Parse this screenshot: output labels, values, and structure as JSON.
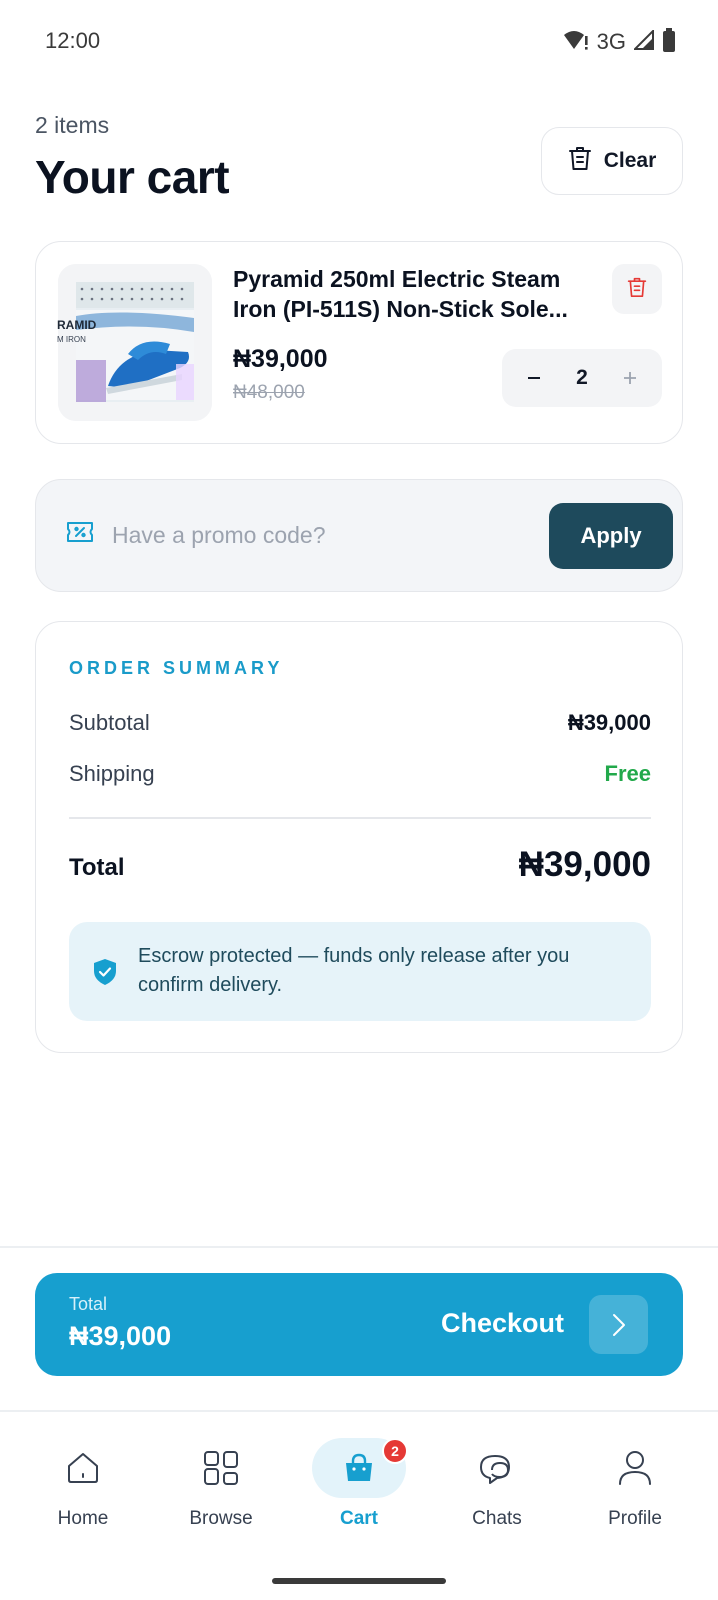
{
  "status_bar": {
    "time": "12:00",
    "network": "3G"
  },
  "header": {
    "items_count": "2 items",
    "title": "Your cart",
    "clear_label": "Clear"
  },
  "cart_items": [
    {
      "title": "Pyramid 250ml Electric Steam Iron (PI-511S) Non-Stick Sole...",
      "image_text": "RAMID",
      "image_subtext": "M IRON",
      "price": "₦39,000",
      "old_price": "₦48,000",
      "quantity": "2"
    }
  ],
  "promo": {
    "placeholder": "Have a promo code?",
    "apply_label": "Apply"
  },
  "summary": {
    "heading": "ORDER SUMMARY",
    "subtotal_label": "Subtotal",
    "subtotal_value": "₦39,000",
    "shipping_label": "Shipping",
    "shipping_value": "Free",
    "total_label": "Total",
    "total_value": "₦39,000",
    "escrow_text": "Escrow protected — funds only release after you confirm delivery."
  },
  "checkout": {
    "total_label": "Total",
    "total_value": "₦39,000",
    "label": "Checkout"
  },
  "nav": {
    "items": [
      {
        "label": "Home",
        "icon": "home-icon"
      },
      {
        "label": "Browse",
        "icon": "grid-icon"
      },
      {
        "label": "Cart",
        "icon": "shopping-bag-icon",
        "badge": "2",
        "active": true
      },
      {
        "label": "Chats",
        "icon": "chat-icon"
      },
      {
        "label": "Profile",
        "icon": "user-icon"
      }
    ]
  },
  "colors": {
    "accent": "#179fcf",
    "apply_button": "#1e4a5c",
    "free": "#22a94b",
    "badge": "#e53935",
    "delete": "#e53935"
  }
}
